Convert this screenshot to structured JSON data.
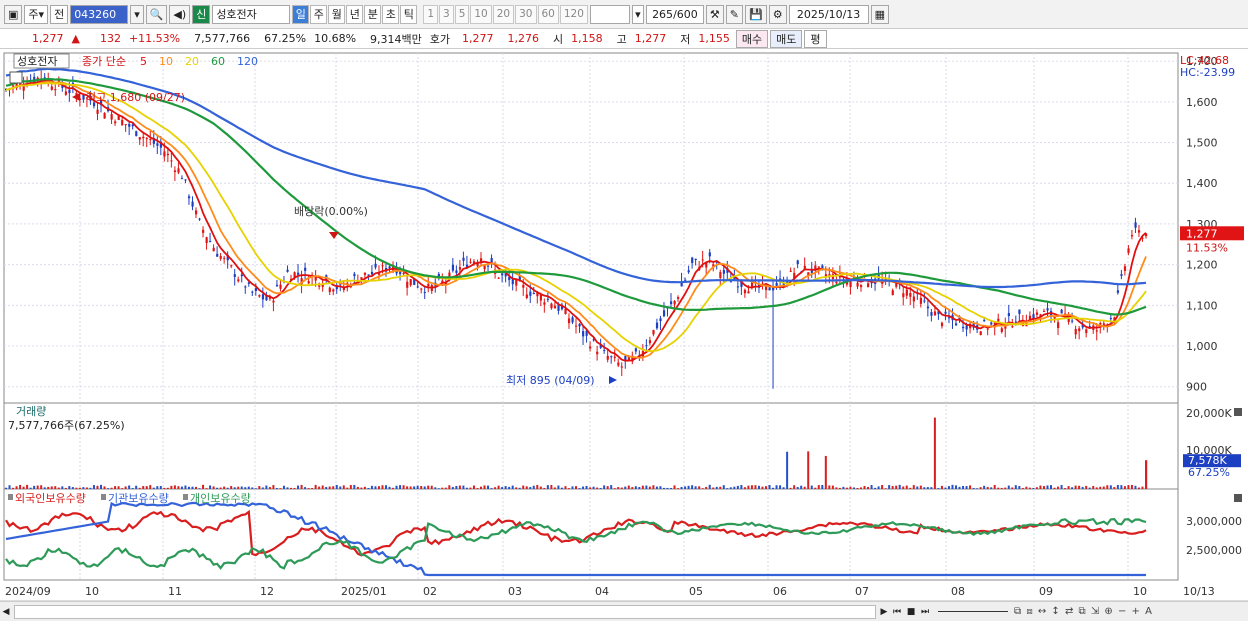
{
  "toolbar": {
    "mode1": "주",
    "mode2": "전",
    "code": "043260",
    "badge": "신",
    "name": "성호전자",
    "periods": [
      "일",
      "주",
      "월",
      "년",
      "분",
      "초",
      "틱"
    ],
    "active_period": "일",
    "numbers": [
      "1",
      "3",
      "5",
      "10",
      "20",
      "30",
      "60",
      "120"
    ],
    "count": "265",
    "count_total": "/600",
    "date": "2025/10/13"
  },
  "quote": {
    "price": "1,277",
    "arrow": "▲",
    "change": "132",
    "change_pct": "+11.53%",
    "volume": "7,577,766",
    "vol_ratio": "67.25%",
    "turnover": "10.68%",
    "amount": "9,314백만",
    "hoga_label": "호가",
    "ask": "1,277",
    "bid": "1,276",
    "open_label": "시",
    "open": "1,158",
    "high_label": "고",
    "high": "1,277",
    "low_label": "저",
    "low": "1,155",
    "buy": "매수",
    "sell": "매도",
    "eval": "평"
  },
  "price_panel": {
    "stock_label": "성호전자",
    "legend_prefix": "종가 단순",
    "ma_labels": [
      "5",
      "10",
      "20",
      "60",
      "120"
    ],
    "ma_colors": [
      "#e01010",
      "#ff8c1a",
      "#e6d200",
      "#1e9a3c",
      "#3462d8"
    ],
    "lc_label": "LC:42.68",
    "hc_label": "HC:-23.99",
    "high_annot": "최고 1,680 (09/27)",
    "low_annot": "최저 895 (04/09)",
    "dividend_annot": "배당락(0.00%)",
    "yticks": [
      "1,700",
      "1,600",
      "1,500",
      "1,400",
      "1,300",
      "1,200",
      "1,100",
      "1,000",
      "900"
    ],
    "cur_price": "1,277",
    "cur_pct": "11.53%"
  },
  "volume_panel": {
    "title": "거래량",
    "sub": "7,577,766주(67.25%)",
    "yticks": [
      "20,000K",
      "10,000K"
    ],
    "cur": "7,578K",
    "cur_pct": "67.25%"
  },
  "holdings_panel": {
    "labels": [
      "외국인보유수량",
      "기관보유수량",
      "개인보유수량"
    ],
    "colors": [
      "#d81e1e",
      "#3462d8",
      "#2e9a58"
    ],
    "yticks": [
      "3,000,000",
      "2,500,000"
    ]
  },
  "xaxis": [
    "2024/09",
    "10",
    "11",
    "12",
    "2025/01",
    "02",
    "03",
    "04",
    "05",
    "06",
    "07",
    "08",
    "09",
    "10",
    "10/13"
  ],
  "chart_data": {
    "type": "candlestick",
    "x_labels": [
      "2024/09",
      "10",
      "11",
      "12",
      "2025/01",
      "02",
      "03",
      "04",
      "05",
      "06",
      "07",
      "08",
      "09",
      "10"
    ],
    "close_points": [
      [
        0,
        1630
      ],
      [
        5,
        1650
      ],
      [
        10,
        1660
      ],
      [
        15,
        1640
      ],
      [
        20,
        1620
      ],
      [
        25,
        1600
      ],
      [
        30,
        1570
      ],
      [
        35,
        1540
      ],
      [
        40,
        1510
      ],
      [
        45,
        1480
      ],
      [
        50,
        1420
      ],
      [
        55,
        1300
      ],
      [
        60,
        1230
      ],
      [
        65,
        1180
      ],
      [
        70,
        1130
      ],
      [
        75,
        1110
      ],
      [
        80,
        1180
      ],
      [
        85,
        1175
      ],
      [
        90,
        1165
      ],
      [
        95,
        1140
      ],
      [
        100,
        1170
      ],
      [
        105,
        1180
      ],
      [
        110,
        1200
      ],
      [
        115,
        1160
      ],
      [
        120,
        1140
      ],
      [
        125,
        1160
      ],
      [
        130,
        1200
      ],
      [
        135,
        1220
      ],
      [
        140,
        1175
      ],
      [
        145,
        1150
      ],
      [
        150,
        1130
      ],
      [
        155,
        1110
      ],
      [
        160,
        1070
      ],
      [
        165,
        1020
      ],
      [
        170,
        980
      ],
      [
        175,
        950
      ],
      [
        180,
        980
      ],
      [
        185,
        1050
      ],
      [
        190,
        1110
      ],
      [
        195,
        1200
      ],
      [
        200,
        1210
      ],
      [
        205,
        1170
      ],
      [
        210,
        1150
      ],
      [
        215,
        1140
      ],
      [
        220,
        1150
      ],
      [
        225,
        1190
      ],
      [
        230,
        1185
      ],
      [
        235,
        1170
      ],
      [
        240,
        1160
      ],
      [
        245,
        1165
      ],
      [
        250,
        1155
      ],
      [
        255,
        1140
      ],
      [
        260,
        1110
      ],
      [
        265,
        1070
      ],
      [
        270,
        1060
      ],
      [
        275,
        1050
      ],
      [
        280,
        1050
      ],
      [
        285,
        1060
      ],
      [
        290,
        1070
      ],
      [
        295,
        1080
      ],
      [
        300,
        1070
      ],
      [
        305,
        1050
      ],
      [
        310,
        1040
      ],
      [
        315,
        1080
      ],
      [
        320,
        1277
      ]
    ],
    "high": 1680,
    "high_date": "09/27",
    "low": 895,
    "low_date": "04/09",
    "last": 1277,
    "volume_spikes_k": [
      [
        222,
        9800
      ],
      [
        228,
        9900
      ],
      [
        233,
        8700
      ],
      [
        264,
        18800
      ],
      [
        359,
        7000
      ],
      [
        379,
        9900
      ]
    ],
    "ylim": [
      860,
      1720
    ]
  }
}
